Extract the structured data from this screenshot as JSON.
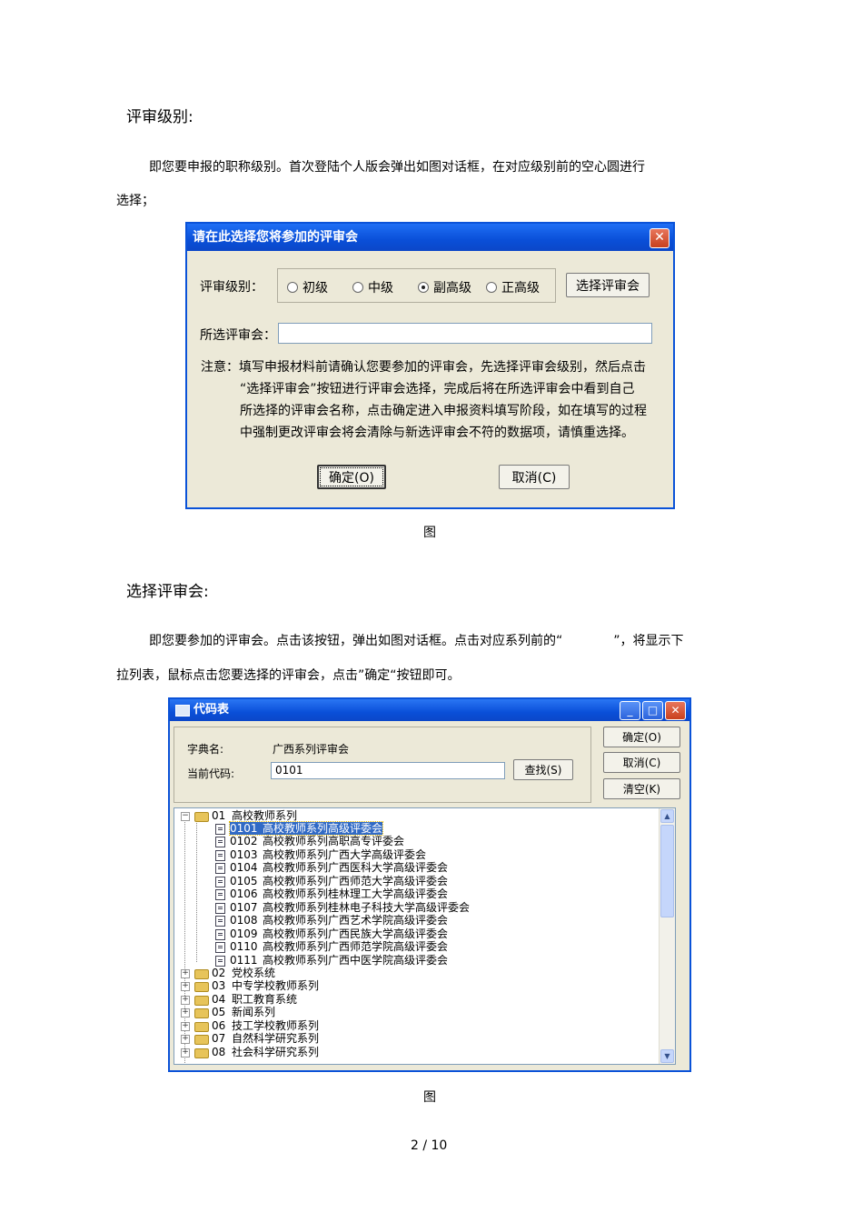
{
  "section1": {
    "heading": "评审级别:",
    "para_line1": "即您要申报的职称级别。首次登陆个人版会弹出如图对话框，在对应级别前的空心圆进行",
    "para_line2": "选择；"
  },
  "dialog1": {
    "title": "请在此选择您将参加的评审会",
    "close_glyph": "✕",
    "level_label": "评审级别：",
    "radios": [
      {
        "label": "初级",
        "checked": false
      },
      {
        "label": "中级",
        "checked": false
      },
      {
        "label": "副高级",
        "checked": true
      },
      {
        "label": "正高级",
        "checked": false
      }
    ],
    "select_button": "选择评审会",
    "selected_label": "所选评审会：",
    "selected_value": "",
    "note_lines": [
      "注意：填写申报材料前请确认您要参加的评审会，先选择评审会级别，然后点击",
      "“选择评审会”按钮进行评审会选择，完成后将在所选评审会中看到自己",
      "所选择的评审会名称，点击确定进入申报资料填写阶段，如在填写的过程",
      "中强制更改评审会将会清除与新选评审会不符的数据项，请慎重选择。"
    ],
    "ok_button": "确定(O)",
    "cancel_button": "取消(C)"
  },
  "caption1": "图",
  "section2": {
    "heading": "选择评审会:",
    "para_line1": "即您要参加的评审会。点击该按钮，弹出如图对话框。点击对应系列前的“　　　　”，将显示下",
    "para_line2": "拉列表，鼠标点击您要选择的评审会，点击”确定“按钮即可。"
  },
  "dialog2": {
    "title": "代码表",
    "dict_label": "字典名:",
    "dict_value": "广西系列评审会",
    "code_label": "当前代码:",
    "code_value": "0101",
    "find_button": "查找(S)",
    "ok_button": "确定(O)",
    "cancel_button": "取消(C)",
    "clear_button": "清空(K)",
    "tree": {
      "top": {
        "code": "01",
        "name": "高校教师系列"
      },
      "children": [
        {
          "code": "0101",
          "name": "高校教师系列高级评委会",
          "selected": true
        },
        {
          "code": "0102",
          "name": "高校教师系列高职高专评委会"
        },
        {
          "code": "0103",
          "name": "高校教师系列广西大学高级评委会"
        },
        {
          "code": "0104",
          "name": "高校教师系列广西医科大学高级评委会"
        },
        {
          "code": "0105",
          "name": "高校教师系列广西师范大学高级评委会"
        },
        {
          "code": "0106",
          "name": "高校教师系列桂林理工大学高级评委会"
        },
        {
          "code": "0107",
          "name": "高校教师系列桂林电子科技大学高级评委会"
        },
        {
          "code": "0108",
          "name": "高校教师系列广西艺术学院高级评委会"
        },
        {
          "code": "0109",
          "name": "高校教师系列广西民族大学高级评委会"
        },
        {
          "code": "0110",
          "name": "高校教师系列广西师范学院高级评委会"
        },
        {
          "code": "0111",
          "name": "高校教师系列广西中医学院高级评委会"
        }
      ],
      "others": [
        {
          "code": "02",
          "name": "党校系统"
        },
        {
          "code": "03",
          "name": "中专学校教师系列"
        },
        {
          "code": "04",
          "name": "职工教育系统"
        },
        {
          "code": "05",
          "name": "新闻系列"
        },
        {
          "code": "06",
          "name": "技工学校教师系列"
        },
        {
          "code": "07",
          "name": "自然科学研究系列"
        },
        {
          "code": "08",
          "name": "社会科学研究系列"
        }
      ]
    }
  },
  "caption2": "图",
  "page_number": "2 / 10"
}
